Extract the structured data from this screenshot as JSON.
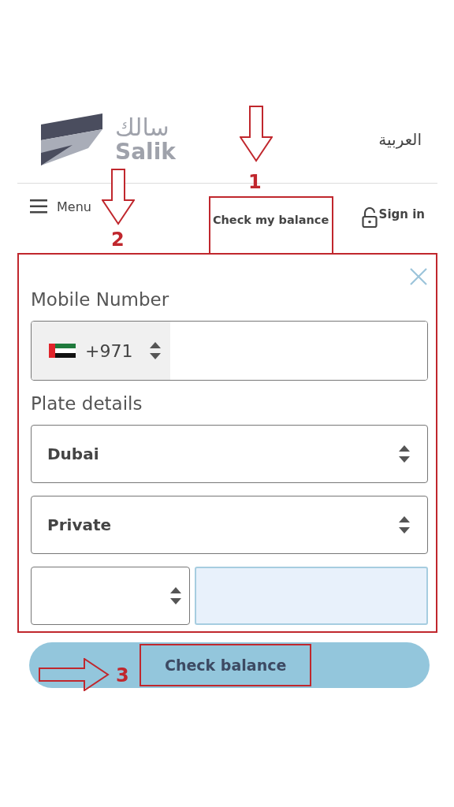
{
  "header": {
    "logo_arabic": "سالك",
    "logo_latin": "Salik",
    "language_link": "العربية"
  },
  "nav": {
    "menu": "Menu",
    "check_balance": "Check my balance",
    "sign_in": "Sign in"
  },
  "form": {
    "mobile_label": "Mobile Number",
    "country_code": "+971",
    "plate_label": "Plate details",
    "emirate": "Dubai",
    "plate_type": "Private"
  },
  "submit": "Check balance",
  "annotations": [
    {
      "number": "1"
    },
    {
      "number": "2"
    },
    {
      "number": "3"
    }
  ]
}
